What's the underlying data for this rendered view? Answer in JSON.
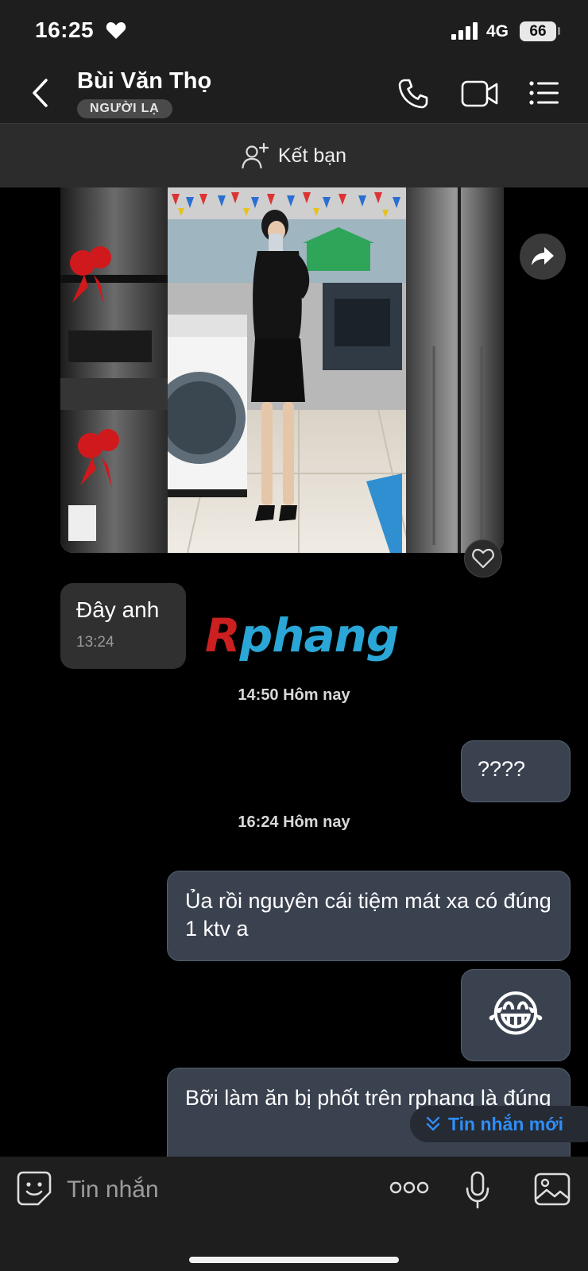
{
  "status": {
    "time": "16:25",
    "network": "4G",
    "battery": "66"
  },
  "header": {
    "name": "Bùi Văn Thọ",
    "badge": "NGƯỜI LẠ"
  },
  "add_friend": {
    "label": "Kết bạn"
  },
  "messages": {
    "incoming": {
      "text": "Đây anh",
      "time": "13:24"
    },
    "day1": "14:50 Hôm nay",
    "out1": "????",
    "day2": "16:24 Hôm nay",
    "out2": "Ủa rồi nguyên cái tiệm mát xa có đúng 1 ktv a",
    "out3": "😂",
    "out4": "Bỡi làm ăn bị phốt trên rphang là đúng"
  },
  "watermark": {
    "part1": "R",
    "part2": "phang"
  },
  "new_messages": {
    "label": "Tin nhắn mới"
  },
  "composer": {
    "placeholder": "Tin nhắn"
  },
  "colors": {
    "background": "#000000",
    "bar": "#1e1e1e",
    "outgoing_bubble": "#3a4250",
    "accent": "#2f8ef5",
    "watermark_red": "#cc1f1f",
    "watermark_blue": "#2aa7d6"
  }
}
